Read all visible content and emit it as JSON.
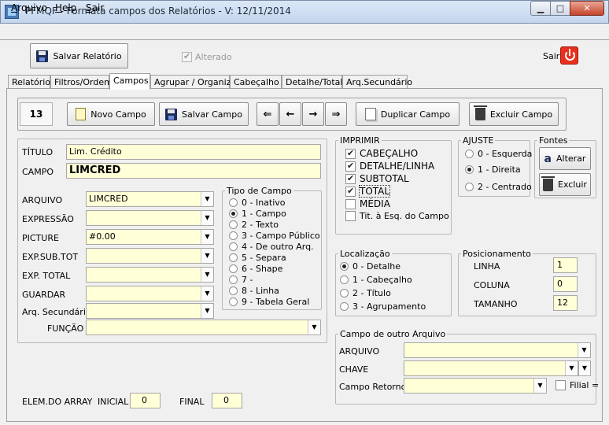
{
  "window": {
    "title": "PFMQF - Formata campos dos Relatórios - V: 12/11/2014"
  },
  "menu": {
    "items": [
      "Arquivo",
      "Help",
      "Sair"
    ]
  },
  "toolbar": {
    "save_label": "Salvar Relatório",
    "alterado_label": "Alterado",
    "alterado_checked": true,
    "sair_label": "Sair"
  },
  "tabs": [
    "Relatório",
    "Filtros/Ordem",
    "Campos",
    "Agrupar / Organizar",
    "Cabeçalho",
    "Detalhe/Total",
    "Arq.Secundário"
  ],
  "active_tab": "Campos",
  "record": {
    "count": "13",
    "novo_campo": "Novo Campo",
    "salvar_campo": "Salvar Campo",
    "nav": [
      "⇐",
      "←",
      "→",
      "⇒"
    ],
    "duplicar_campo": "Duplicar Campo",
    "excluir_campo": "Excluir Campo"
  },
  "form": {
    "titulo_label": "TÍTULO",
    "titulo_value": "Lim. Crédito",
    "campo_label": "CAMPO",
    "campo_value": "LIMCRED",
    "arquivo_label": "ARQUIVO",
    "arquivo_value": "LIMCRED",
    "expressao_label": "EXPRESSÃO",
    "expressao_value": "",
    "picture_label": "PICTURE",
    "picture_value": "#0.00",
    "expsubtot_label": "EXP.SUB.TOT",
    "expsubtot_value": "",
    "exptotal_label": "EXP. TOTAL",
    "exptotal_value": "",
    "guardar_label": "GUARDAR",
    "guardar_value": "",
    "arqsec_label": "Arq. Secundário",
    "arqsec_value": "",
    "funcao_label": "FUNÇÃO",
    "funcao_value": ""
  },
  "tipo_campo": {
    "legend": "Tipo de Campo",
    "options": [
      "0 - Inativo",
      "1 - Campo",
      "2 - Texto",
      "3 - Campo Público",
      "4 - De outro Arq.",
      "5 - Separa",
      "6 - Shape",
      "7 -",
      "8 - Linha",
      "9 - Tabela Geral"
    ],
    "selected": 1
  },
  "imprimir": {
    "legend": "IMPRIMIR",
    "options": [
      {
        "label": "CABEÇALHO",
        "checked": true
      },
      {
        "label": "DETALHE/LINHA",
        "checked": true
      },
      {
        "label": "SUBTOTAL",
        "checked": true
      },
      {
        "label": "TOTAL",
        "checked": true
      },
      {
        "label": "MÉDIA",
        "checked": false
      },
      {
        "label": "Tit. à Esq. do Campo",
        "checked": false
      }
    ]
  },
  "ajuste": {
    "legend": "AJUSTE",
    "options": [
      "0 - Esquerda",
      "1 - Direita",
      "2 - Centrado"
    ],
    "selected": 1
  },
  "fontes": {
    "legend": "Fontes",
    "alterar": "Alterar",
    "excluir": "Excluir"
  },
  "localizacao": {
    "legend": "Localização",
    "options": [
      "0 - Detalhe",
      "1 - Cabeçalho",
      "2 - Título",
      "3 - Agrupamento"
    ],
    "selected": 0
  },
  "posicionamento": {
    "legend": "Posicionamento",
    "linha_label": "LINHA",
    "linha_value": "1",
    "coluna_label": "COLUNA",
    "coluna_value": "0",
    "tamanho_label": "TAMANHO",
    "tamanho_value": "12"
  },
  "outro_arquivo": {
    "legend": "Campo de outro Arquivo",
    "arquivo_label": "ARQUIVO",
    "chave_label": "CHAVE",
    "retorno_label": "Campo Retorno",
    "filial_label": "Filial ="
  },
  "array": {
    "elem_label": "ELEM.DO ARRAY",
    "inicial_label": "INICIAL",
    "inicial_value": "0",
    "final_label": "FINAL",
    "final_value": "0"
  }
}
